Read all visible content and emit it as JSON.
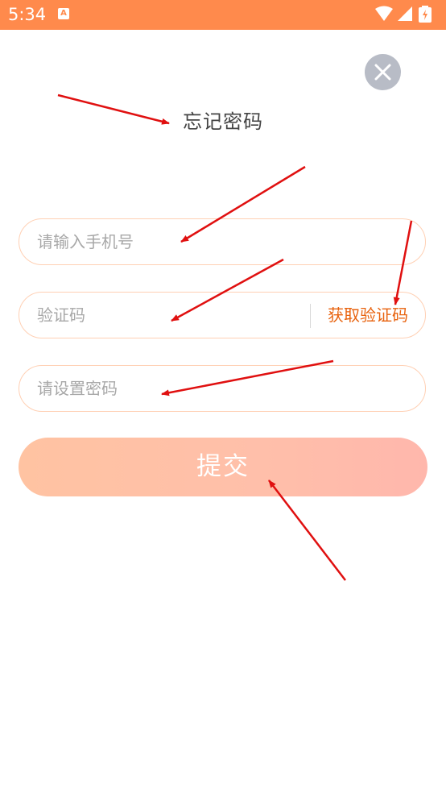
{
  "status_bar": {
    "time": "5:34",
    "app_icon": "app-notification-icon",
    "icons": [
      "wifi-icon",
      "signal-icon",
      "battery-icon"
    ],
    "background": "#ff8a4c"
  },
  "page": {
    "title": "忘记密码",
    "close_icon": "close-icon"
  },
  "form": {
    "phone": {
      "placeholder": "请输入手机号",
      "value": ""
    },
    "code": {
      "placeholder": "验证码",
      "value": "",
      "get_code_label": "获取验证码"
    },
    "password": {
      "placeholder": "请设置密码",
      "value": ""
    },
    "submit_label": "提交"
  },
  "colors": {
    "accent": "#e8630f",
    "field_border": "#ffd0b4",
    "submit_gradient_start": "#ffc3a2",
    "submit_gradient_end": "#ffb7ac",
    "annotation_arrow": "#e01010"
  }
}
